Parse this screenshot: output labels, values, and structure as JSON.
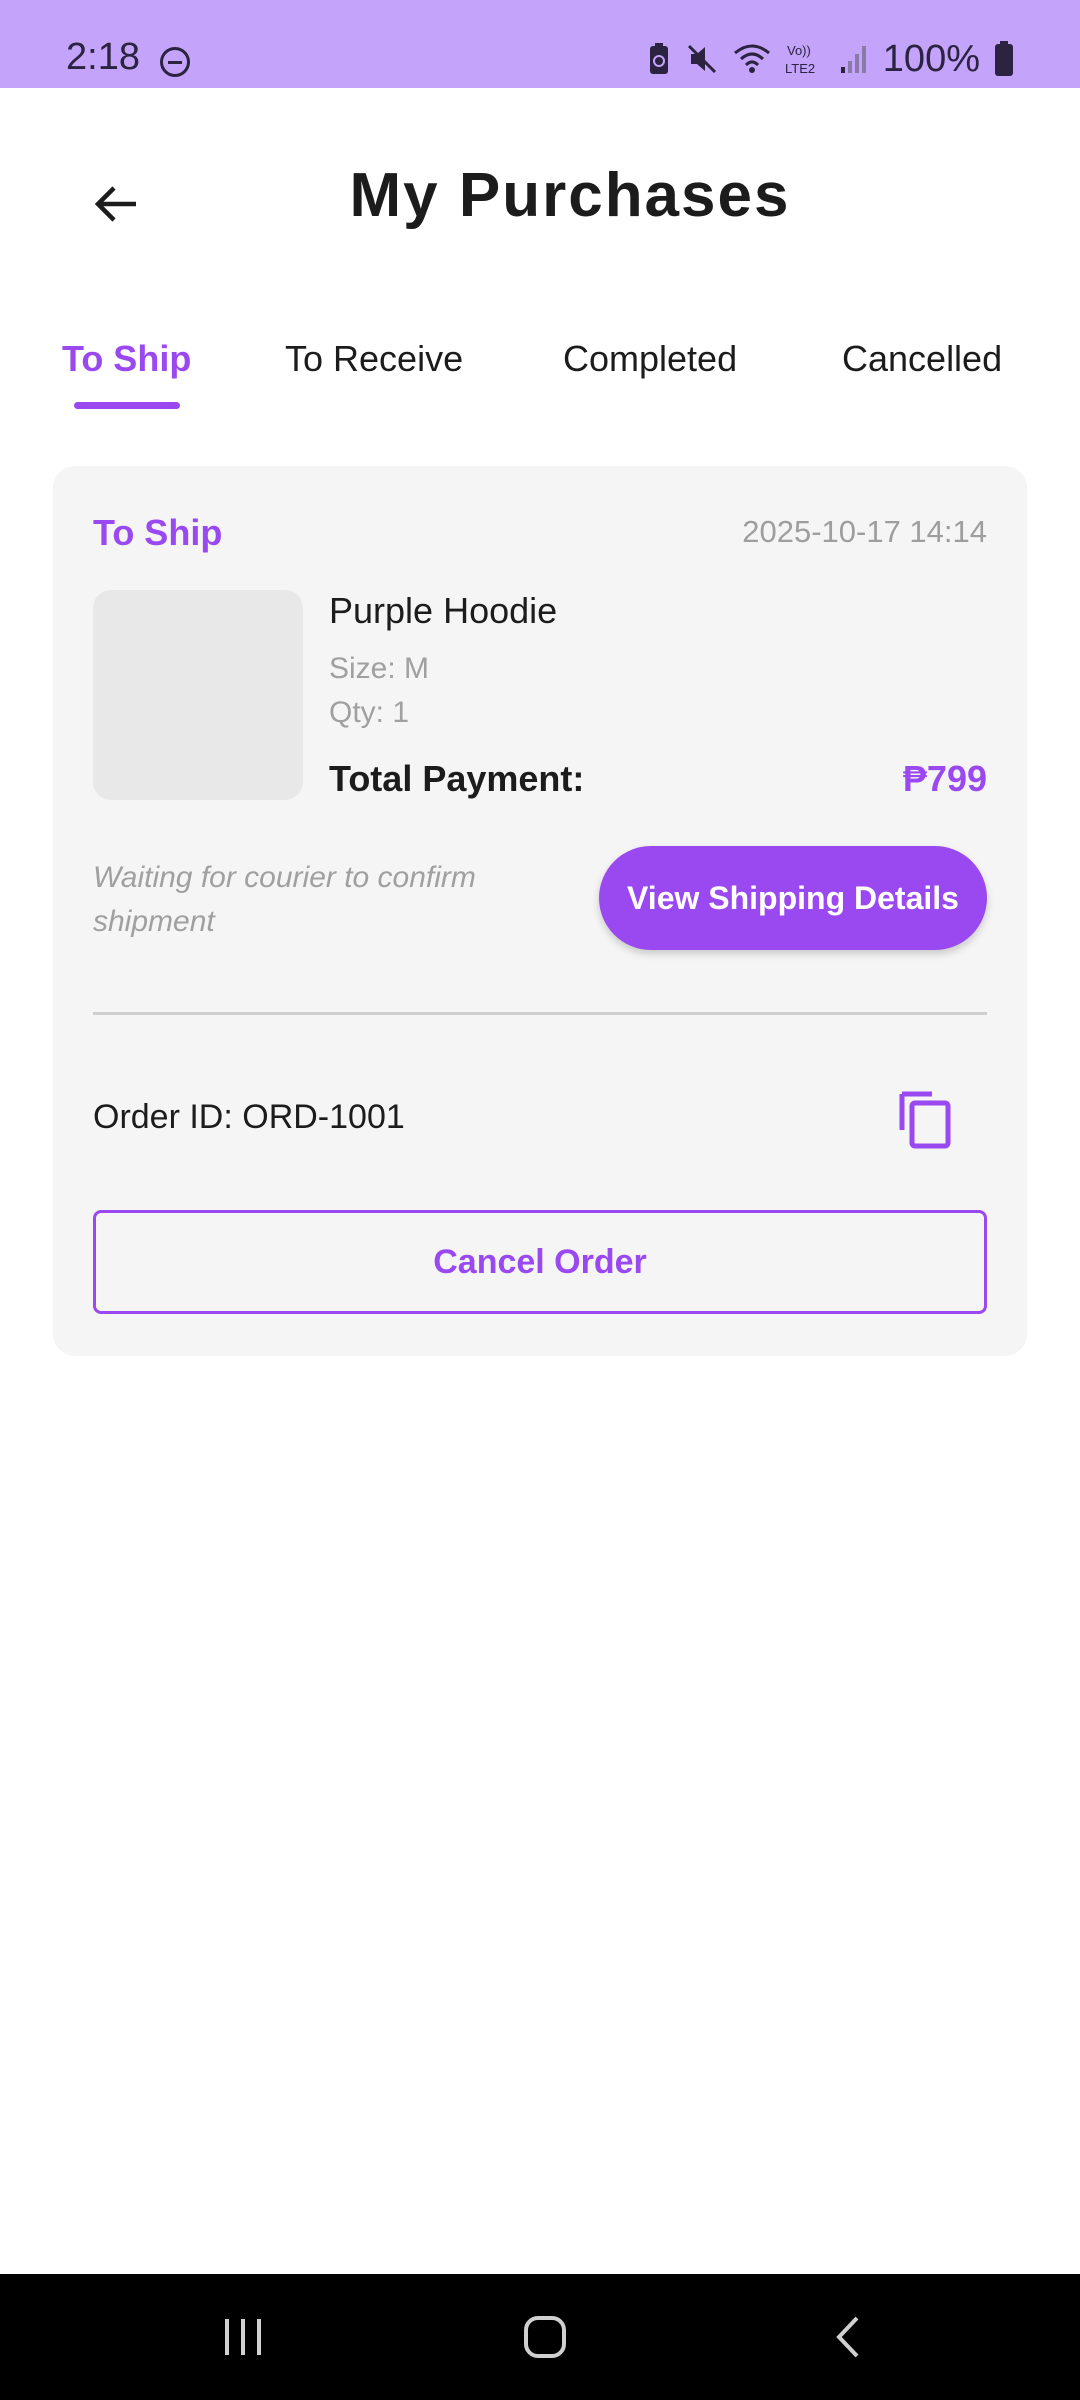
{
  "status_bar": {
    "time": "2:18",
    "battery_percent": "100%",
    "icons": [
      "do-not-disturb-icon",
      "battery-saver-icon",
      "mute-icon",
      "wifi-icon",
      "volte-lte2-icon",
      "signal-icon",
      "battery-icon"
    ]
  },
  "header": {
    "title": "My Purchases",
    "back_icon": "arrow-left-icon"
  },
  "tabs": [
    {
      "label": "To Ship",
      "active": true
    },
    {
      "label": "To Receive",
      "active": false
    },
    {
      "label": "Completed",
      "active": false
    },
    {
      "label": "Cancelled",
      "active": false
    }
  ],
  "order": {
    "status": "To Ship",
    "date": "2025-10-17 14:14",
    "product_name": "Purple Hoodie",
    "size": "Size: M",
    "qty": "Qty: 1",
    "total_label": "Total Payment:",
    "total_value": "₱799",
    "note": "Waiting for courier to confirm shipment",
    "shipping_button": "View Shipping Details",
    "order_id": "Order ID: ORD-1001",
    "copy_icon": "copy-icon",
    "cancel_button": "Cancel Order"
  },
  "nav_bar": {
    "icons": [
      "recent-apps-icon",
      "home-icon",
      "back-icon"
    ]
  },
  "colors": {
    "accent": "#9a48f0",
    "status_bar": "#c4a3fb",
    "card_bg": "#f5f5f5"
  }
}
